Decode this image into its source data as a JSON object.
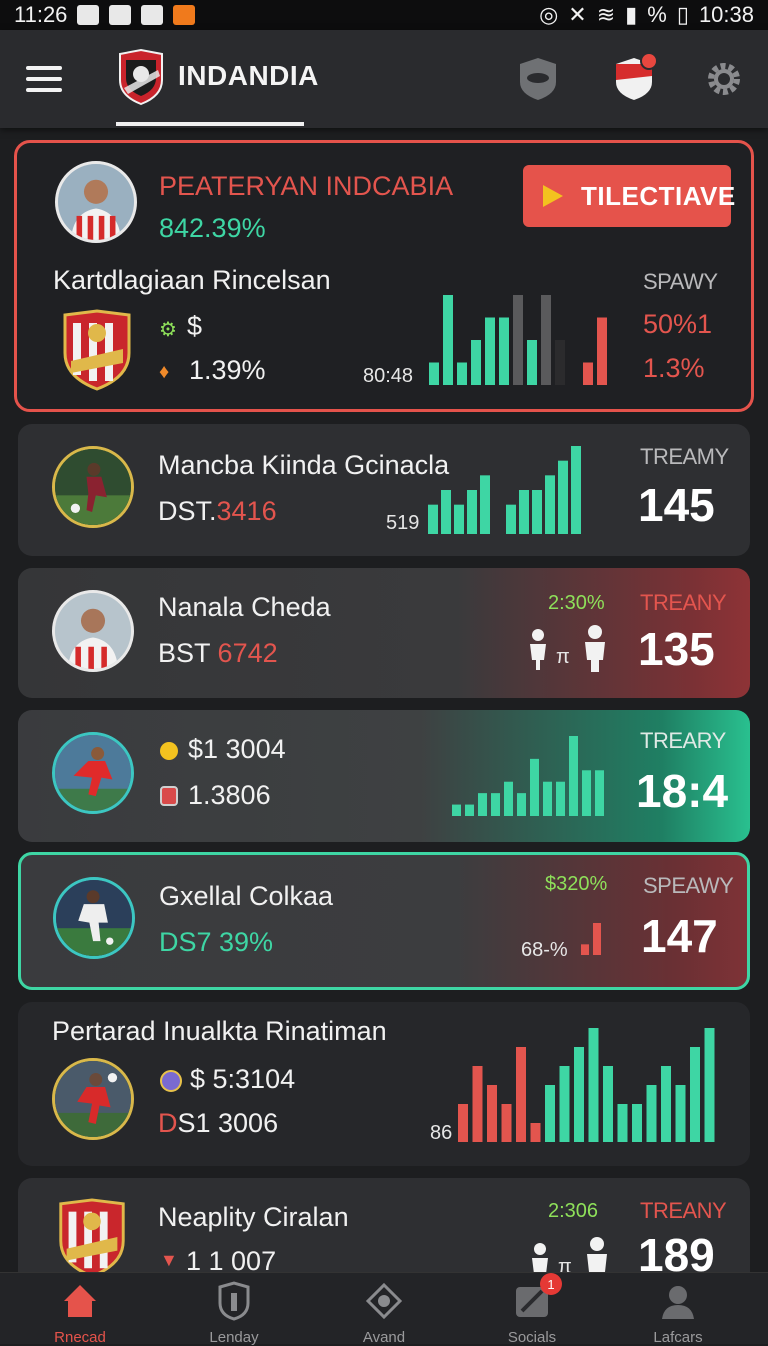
{
  "status_bar": {
    "time_left": "11:26",
    "battery": "%",
    "time_right": "10:38"
  },
  "app": {
    "title": "INDANDIA"
  },
  "featured": {
    "title": "PEATERYAN INDCABIA",
    "subtitle": "842.39%",
    "cta_label": "TILECTIAVE",
    "team": "Kartdlagiaan Rincelsan",
    "stat_1": "$",
    "stat_2": "1.39%",
    "bars_label": "80:48",
    "right_label": "SPAWY",
    "right_value_1": "50%1",
    "right_value_2": "1.3%"
  },
  "cards": [
    {
      "name": "Mancba  Kiinda Gcinacla",
      "code": "DST.",
      "code_value": "3416",
      "bars_label": "519",
      "right_label": "TREAMY",
      "value": "145"
    },
    {
      "name": "Nanala Cheda",
      "code": "BST",
      "code_value": "6742",
      "top_stat": "2:30%",
      "icons_label": "π",
      "right_label": "TREANY",
      "value": "135"
    },
    {
      "stat_1": "$1 3004",
      "stat_2": "1.3806",
      "right_label": "TREARY",
      "value": "18:4"
    },
    {
      "name": "Gxellal Colkaa",
      "code": "DS7 39%",
      "top_stat": "$320%",
      "bars_label": "68-%",
      "right_label": "SPEAWY",
      "value": "147"
    },
    {
      "name": "Pertarad Inualkta Rinatiman",
      "stat_1": "$ 5:3104",
      "code": "D",
      "code_value": "S1 3006",
      "bars_label": "86"
    },
    {
      "name": "Neaplity Ciralan",
      "stat_1": "1 1 007",
      "top_stat": "2:306",
      "icons_label": "π",
      "right_label": "TREANY",
      "value": "189"
    }
  ],
  "chart_data": [
    {
      "type": "bar",
      "series": [
        {
          "values": [
            1,
            4,
            1,
            2,
            3,
            3,
            4,
            2,
            4,
            2,
            0,
            1,
            3
          ]
        }
      ]
    },
    {
      "type": "bar",
      "series": [
        {
          "values": [
            2,
            3,
            2,
            3,
            4,
            0,
            2,
            3,
            3,
            4,
            5,
            6
          ]
        }
      ]
    },
    {
      "type": "bar",
      "series": [
        {
          "values": [
            1,
            1,
            2,
            2,
            3,
            2,
            5,
            3,
            3,
            7,
            4,
            4
          ]
        }
      ]
    },
    {
      "type": "bar",
      "series": [
        {
          "values": [
            1,
            3
          ]
        }
      ]
    },
    {
      "type": "bar",
      "series": [
        {
          "values": [
            2,
            4,
            3,
            2,
            5,
            1,
            3,
            4,
            5,
            6,
            4,
            2,
            2,
            3,
            4,
            3,
            5,
            6
          ]
        }
      ]
    }
  ],
  "bottom_nav": [
    {
      "label": "Rnecad",
      "active": true
    },
    {
      "label": "Lenday"
    },
    {
      "label": "Avand"
    },
    {
      "label": "Socials",
      "badge": "1"
    },
    {
      "label": "Lafcars"
    }
  ]
}
